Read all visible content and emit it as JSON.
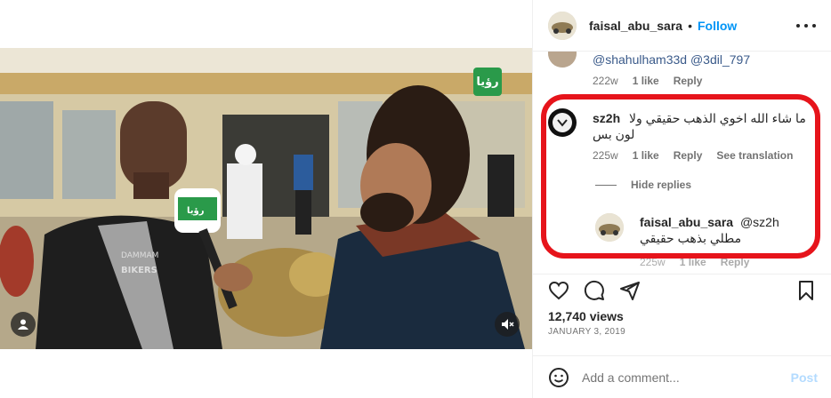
{
  "header": {
    "username": "faisal_abu_sara",
    "separator": "•",
    "follow_label": "Follow"
  },
  "comments": [
    {
      "mentions": "@shahulham33d @3dil_797",
      "age": "222w",
      "likes": "1 like",
      "reply_label": "Reply"
    },
    {
      "username": "sz2h",
      "text_line1": "ما شاء الله اخوي الذهب حقيقي ولا",
      "text_line2": "لون بس",
      "age": "225w",
      "likes": "1 like",
      "reply_label": "Reply",
      "translate_label": "See translation"
    }
  ],
  "hide_replies_label": "Hide replies",
  "reply": {
    "username": "faisal_abu_sara",
    "mention": "@sz2h",
    "text": "مطلي بذهب حقيقي",
    "age": "225w",
    "likes": "1 like",
    "reply_label": "Reply"
  },
  "stats": {
    "views": "12,740 views",
    "date": "JANUARY 3, 2019"
  },
  "add_comment": {
    "placeholder": "Add a comment...",
    "post_label": "Post"
  },
  "video": {
    "channel_logo_text": "رؤيا",
    "jacket_patch_1": "DAMMAM",
    "jacket_patch_2": "BIKERS",
    "mic_logo_text": "رؤيا"
  },
  "icons": [
    "heart-icon",
    "comment-icon",
    "share-icon",
    "bookmark-icon",
    "emoji-icon",
    "more-icon",
    "mute-icon",
    "user-icon"
  ],
  "colors": {
    "accent": "#0095f6",
    "highlight": "#e6141b",
    "muted": "#737373"
  }
}
